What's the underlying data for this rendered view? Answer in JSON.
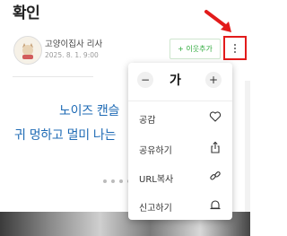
{
  "title": "확인",
  "post": {
    "author": "고양이집사 리사",
    "date": "2025. 8. 1. 9:00",
    "follow_label": "+ 이웃추가"
  },
  "content": {
    "line1": "노이즈 캔슬",
    "line2": "귀 멍하고 멀미 나는"
  },
  "menu": {
    "font_minus": "−",
    "font_label": "가",
    "font_plus": "+",
    "items": [
      {
        "label": "공감",
        "icon": "heart-icon"
      },
      {
        "label": "공유하기",
        "icon": "share-icon"
      },
      {
        "label": "URL복사",
        "icon": "link-icon"
      },
      {
        "label": "신고하기",
        "icon": "bell-icon"
      }
    ]
  },
  "colors": {
    "accent_blue": "#1f6bb5",
    "follow_green": "#2eaa3b",
    "highlight_red": "#e21b1b"
  }
}
